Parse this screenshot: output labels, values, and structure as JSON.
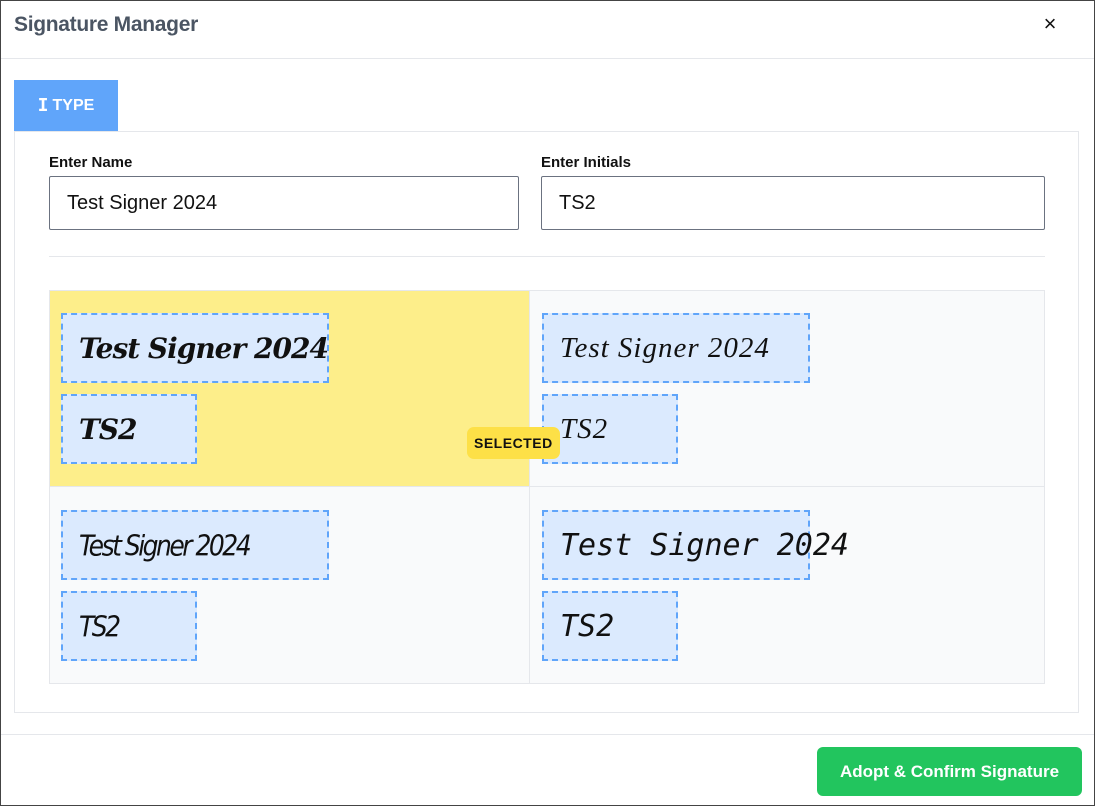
{
  "dialog": {
    "title": "Signature Manager",
    "close_symbol": "×"
  },
  "tabs": [
    {
      "label": "TYPE",
      "icon": "text-cursor-icon",
      "icon_glyph": "Ι",
      "active": true
    }
  ],
  "form": {
    "name_label": "Enter Name",
    "name_value": "Test Signer 2024",
    "initials_label": "Enter Initials",
    "initials_value": "TS2"
  },
  "selected_badge": "SELECTED",
  "signature_options": [
    {
      "signature": "Test Signer 2024",
      "initials": "TS2",
      "selected": true
    },
    {
      "signature": "Test Signer 2024",
      "initials": "TS2",
      "selected": false
    },
    {
      "signature": "Test Signer 2024",
      "initials": "TS2",
      "selected": false
    },
    {
      "signature": "Test Signer 2024",
      "initials": "TS2",
      "selected": false
    }
  ],
  "footer": {
    "adopt_label": "Adopt & Confirm Signature"
  },
  "colors": {
    "tab_active": "#60a5fa",
    "selected_cell": "#fdee8a",
    "badge": "#fde047",
    "signature_box": "#dbeafe",
    "signature_border": "#60a5fa",
    "adopt_button": "#22c55e"
  }
}
